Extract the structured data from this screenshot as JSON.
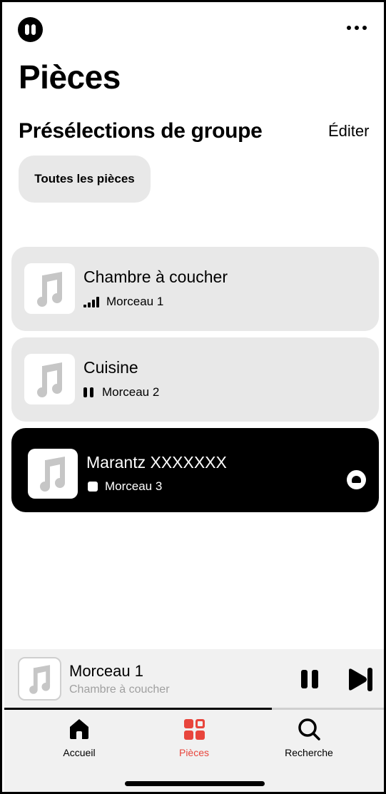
{
  "header": {
    "title": "Pièces",
    "more_icon": "more-horizontal-icon",
    "playback_icon": "pause-circle-icon"
  },
  "presets": {
    "title": "Présélections de groupe",
    "edit_label": "Éditer",
    "chips": [
      "Toutes les pièces"
    ]
  },
  "rooms": [
    {
      "name": "Chambre à coucher",
      "track": "Morceau 1",
      "status_icon": "signal-bars-icon",
      "active": false
    },
    {
      "name": "Cuisine",
      "track": "Morceau 2",
      "status_icon": "pause-icon",
      "active": false
    },
    {
      "name": "Marantz XXXXXXX",
      "track": "Morceau 3",
      "status_icon": "stop-icon",
      "active": true,
      "accessory_icon": "group-speaker-icon"
    }
  ],
  "now_playing": {
    "title": "Morceau 1",
    "subtitle": "Chambre à coucher",
    "progress": 0.7
  },
  "tabs": [
    {
      "label": "Accueil",
      "icon": "home-icon",
      "selected": false
    },
    {
      "label": "Pièces",
      "icon": "rooms-grid-icon",
      "selected": true
    },
    {
      "label": "Recherche",
      "icon": "search-icon",
      "selected": false
    }
  ],
  "colors": {
    "accent": "#e8453c",
    "card_background": "#e8e8e8",
    "active_card_background": "#000000",
    "muted_text": "#a0a0a0"
  }
}
